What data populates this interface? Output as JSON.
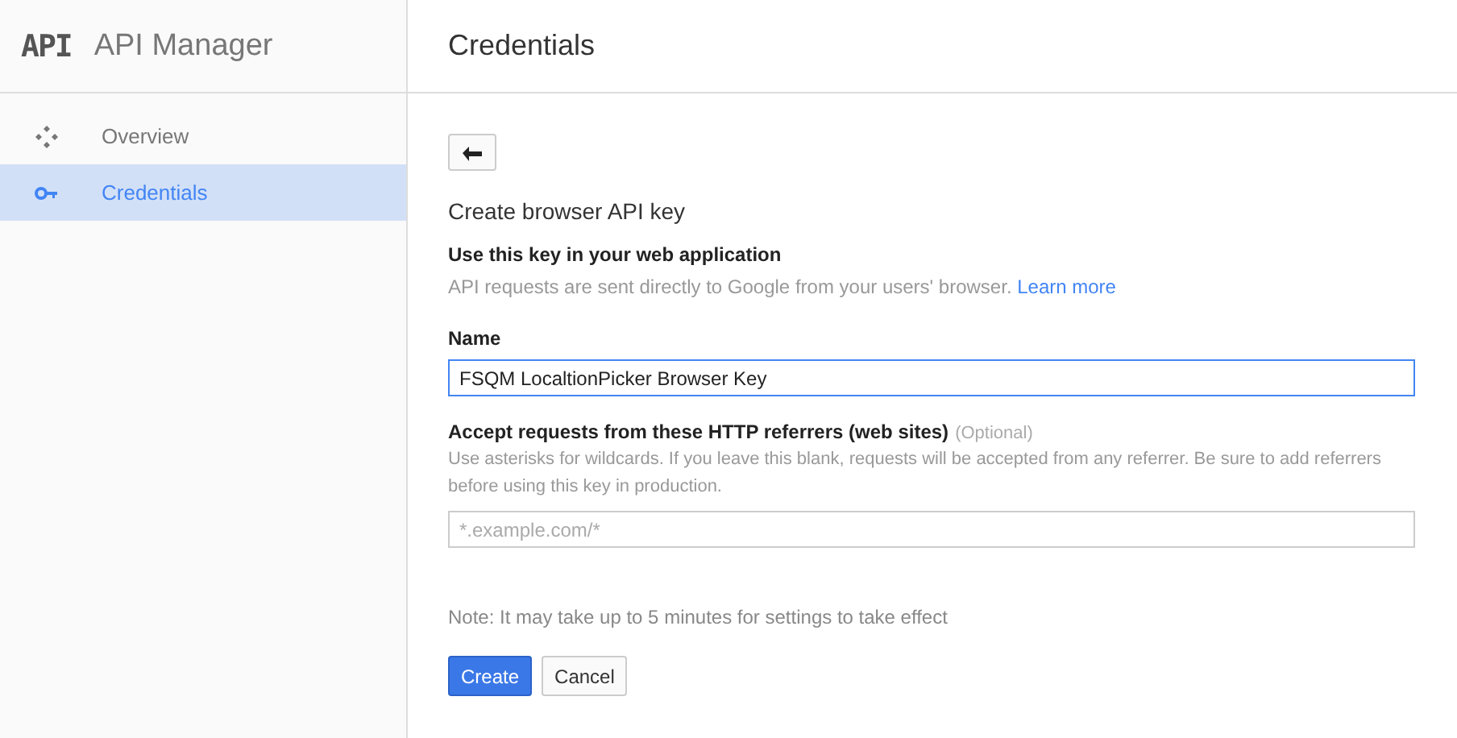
{
  "sidebar": {
    "logo": "API",
    "title": "API Manager",
    "items": [
      {
        "label": "Overview",
        "kind": "overview",
        "selected": false
      },
      {
        "label": "Credentials",
        "kind": "key",
        "selected": true
      }
    ]
  },
  "page": {
    "title": "Credentials"
  },
  "form": {
    "heading": "Create browser API key",
    "intro_title": "Use this key in your web application",
    "intro_text": "API requests are sent directly to Google from your users' browser.",
    "intro_link": "Learn more",
    "name_label": "Name",
    "name_value": "FSQM LocaltionPicker Browser Key",
    "referrers_label": "Accept requests from these HTTP referrers (web sites)",
    "referrers_optional": "(Optional)",
    "referrers_help": "Use asterisks for wildcards. If you leave this blank, requests will be accepted from any referrer. Be sure to add referrers before using this key in production.",
    "referrers_placeholder": "*.example.com/*",
    "note": "Note: It may take up to 5 minutes for settings to take effect",
    "buttons": [
      {
        "label": "Create",
        "kind": "primary"
      },
      {
        "label": "Cancel",
        "kind": "secondary"
      }
    ]
  }
}
